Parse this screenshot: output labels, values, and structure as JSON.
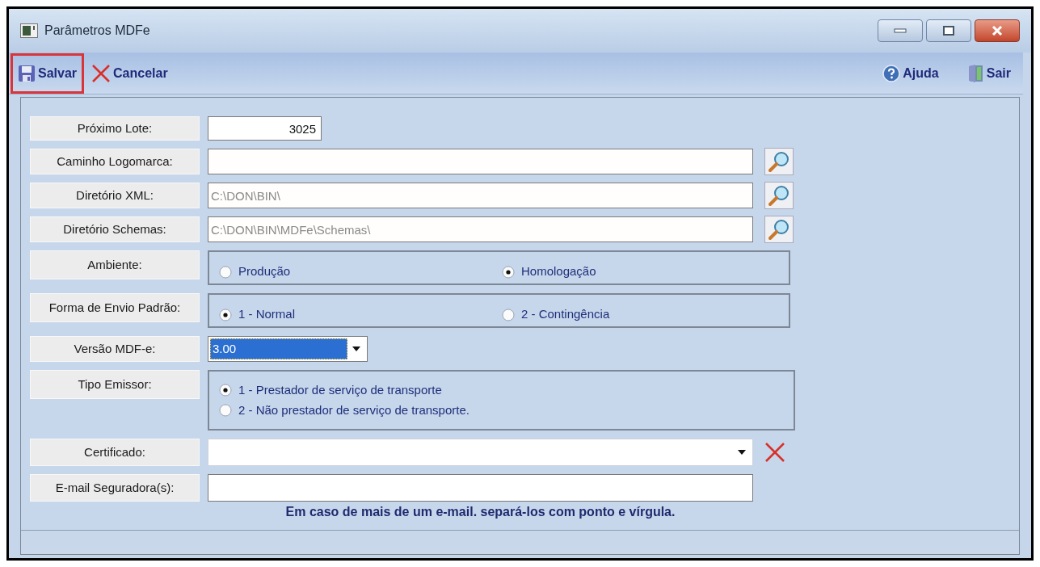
{
  "window": {
    "title": "Parâmetros MDFe"
  },
  "toolbar": [
    {
      "kind": "save",
      "label": "Salvar",
      "highlighted": true
    },
    {
      "kind": "cancel",
      "label": "Cancelar",
      "highlighted": false
    },
    {
      "kind": "help",
      "label": "Ajuda",
      "highlighted": false
    },
    {
      "kind": "exit",
      "label": "Sair",
      "highlighted": false
    }
  ],
  "rows": [
    {
      "kind": "number",
      "label": "Próximo Lote:",
      "value": "3025"
    },
    {
      "kind": "path",
      "label": "Caminho Logomarca:"
    },
    {
      "kind": "path",
      "label": "Diretório XML:",
      "value": "C:\\DON\\BIN\\"
    },
    {
      "kind": "path",
      "label": "Diretório Schemas:",
      "value": "C:\\DON\\BIN\\MDFe\\Schemas\\"
    },
    {
      "kind": "radio_row",
      "label": "Ambiente:",
      "options": [
        {
          "label": "Produção",
          "selected": false
        },
        {
          "label": "Homologação",
          "selected": true
        }
      ]
    },
    {
      "kind": "radio_row",
      "label": "Forma de Envio Padrão:",
      "options": [
        {
          "label": "1 - Normal",
          "selected": true
        },
        {
          "label": "2 - Contingência",
          "selected": false
        }
      ]
    },
    {
      "kind": "select",
      "label": "Versão MDF-e:",
      "value": "3.00"
    },
    {
      "kind": "radio_column",
      "label": "Tipo Emissor:",
      "options": [
        {
          "label": "1 - Prestador de serviço de transporte",
          "selected": true
        },
        {
          "label": "2 - Não prestador de serviço de transporte.",
          "selected": false
        }
      ]
    },
    {
      "kind": "combo",
      "label": "Certificado:"
    },
    {
      "kind": "email",
      "label": "E-mail Seguradora(s):",
      "hint": "Em caso de mais de um e-mail. separá-los com ponto e vírgula."
    }
  ]
}
